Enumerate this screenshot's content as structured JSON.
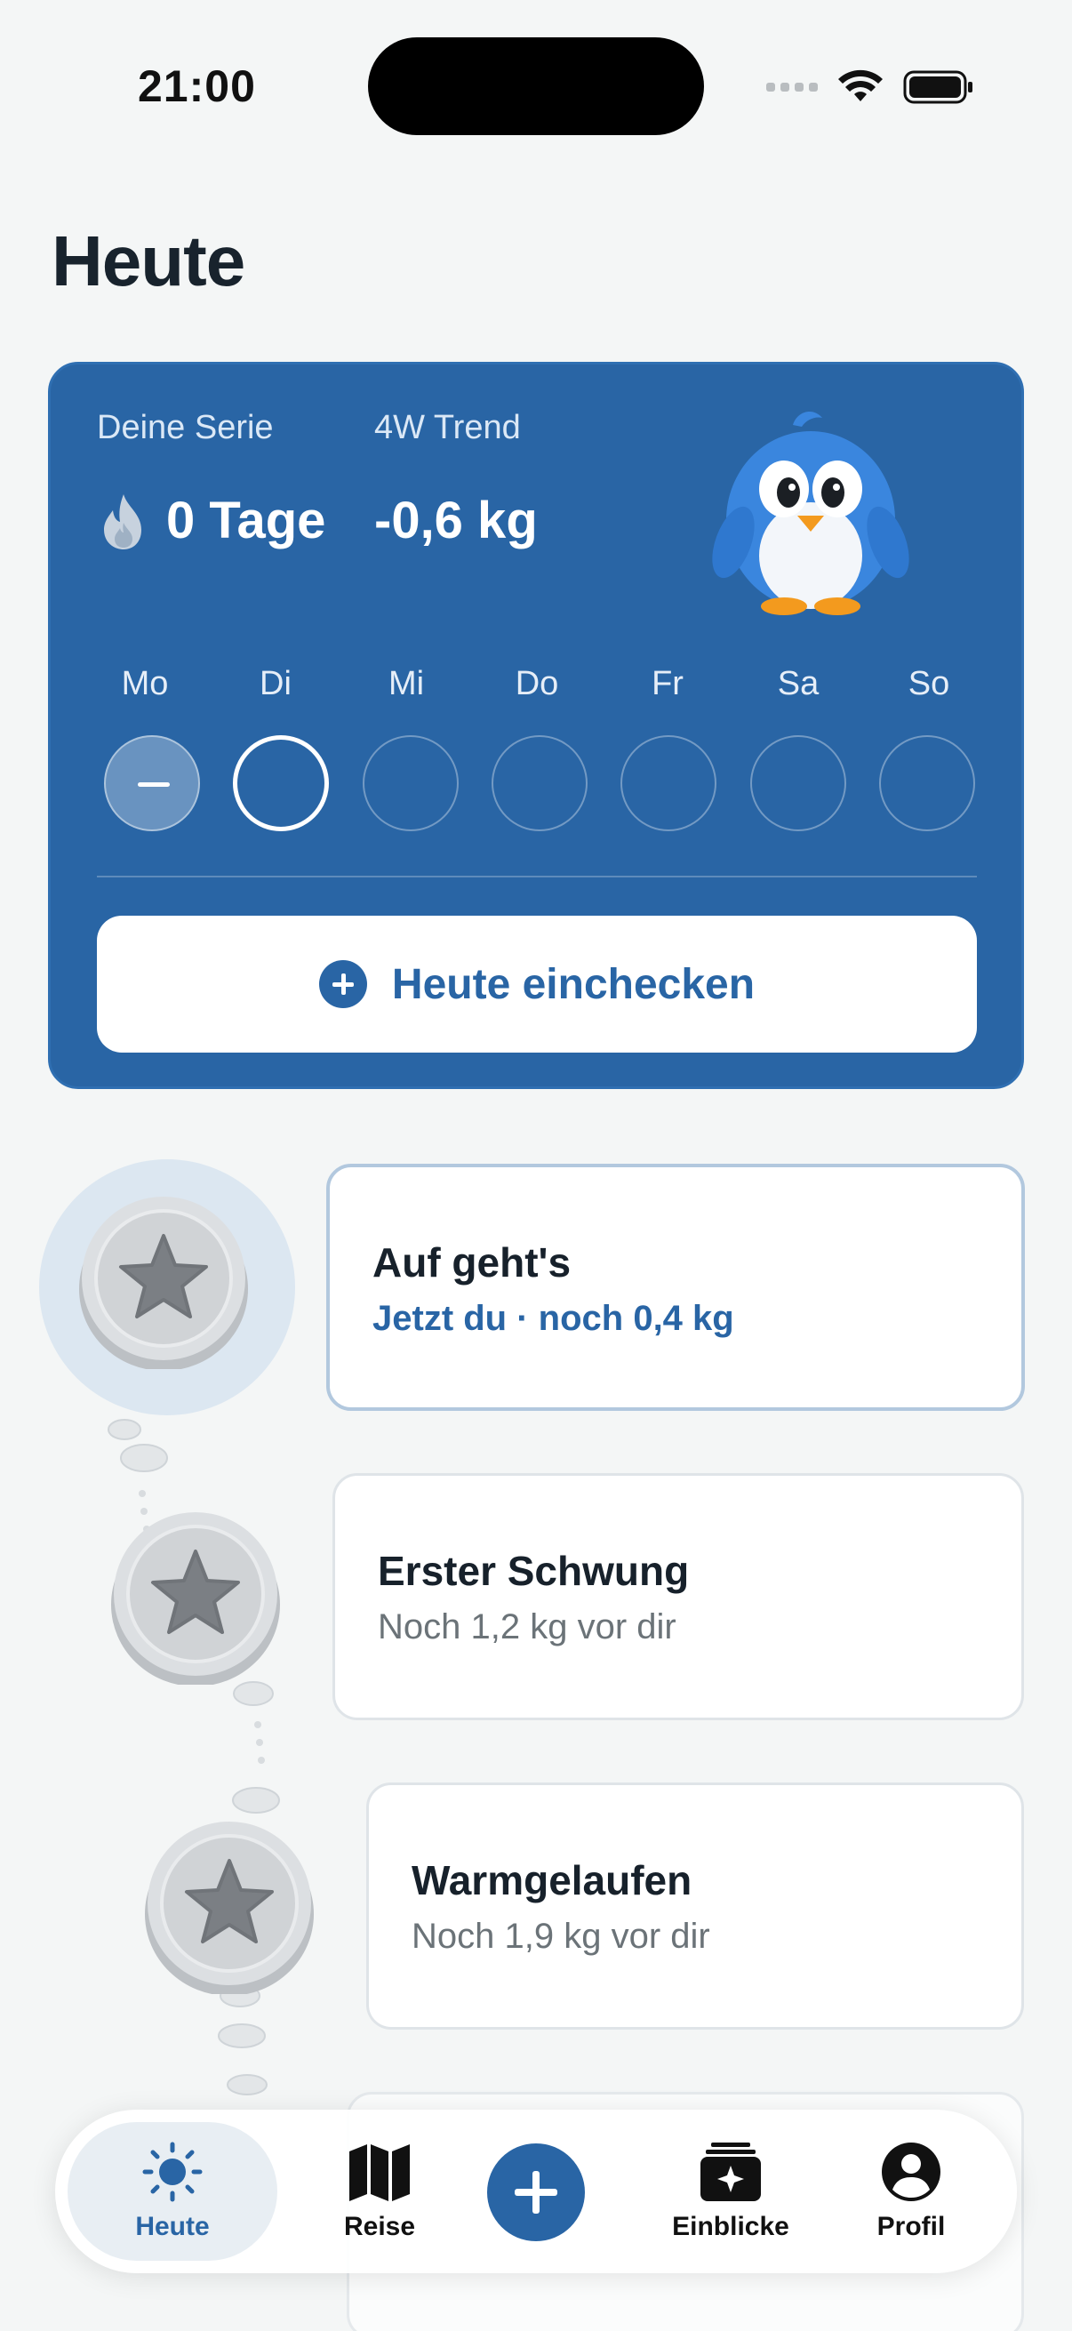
{
  "status_bar": {
    "time": "21:00"
  },
  "page": {
    "title": "Heute"
  },
  "streak": {
    "serie_label": "Deine Serie",
    "serie_value": "0 Tage",
    "trend_label": "4W Trend",
    "trend_value": "-0,6 kg",
    "weekdays": [
      "Mo",
      "Di",
      "Mi",
      "Do",
      "Fr",
      "Sa",
      "So"
    ],
    "checkin_label": "Heute einchecken"
  },
  "milestones": [
    {
      "title": "Auf geht's",
      "subtitle": "Jetzt du · noch 0,4 kg"
    },
    {
      "title": "Erster Schwung",
      "subtitle": "Noch 1,2 kg vor dir"
    },
    {
      "title": "Warmgelaufen",
      "subtitle": "Noch 1,9 kg vor dir"
    }
  ],
  "tab_bar": {
    "tabs": [
      {
        "label": "Heute",
        "icon": "sun-icon"
      },
      {
        "label": "Reise",
        "icon": "map-icon"
      },
      {
        "label": "Einblicke",
        "icon": "sparkle-stack-icon"
      },
      {
        "label": "Profil",
        "icon": "person-icon"
      }
    ],
    "add_icon": "plus-icon"
  },
  "colors": {
    "accent": "#2965a5",
    "background": "#f4f6f6",
    "card_border": "#b2c8de"
  }
}
